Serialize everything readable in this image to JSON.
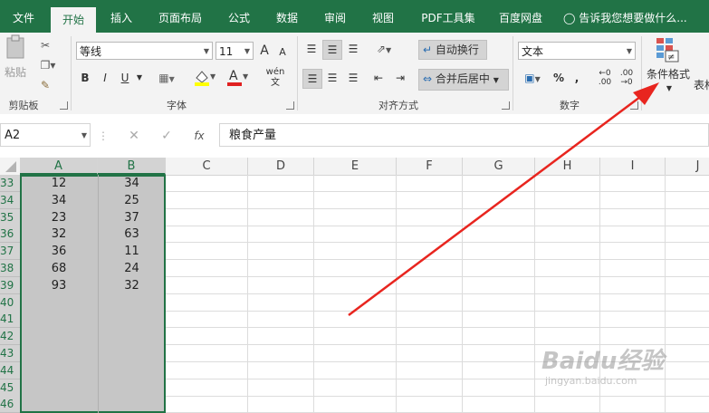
{
  "tabs": [
    "文件",
    "开始",
    "插入",
    "页面布局",
    "公式",
    "数据",
    "审阅",
    "视图",
    "PDF工具集",
    "百度网盘"
  ],
  "active_tab": "开始",
  "tell_me": "告诉我您想要做什么...",
  "ribbon": {
    "clipboard": {
      "paste": "粘贴",
      "label": "剪贴板"
    },
    "font": {
      "name": "等线",
      "size": "11",
      "label": "字体",
      "bold": "B",
      "italic": "I",
      "underline": "U",
      "grow": "A",
      "shrink": "A",
      "wen": "wén"
    },
    "alignment": {
      "wrap": "自动换行",
      "merge": "合并后居中",
      "label": "对齐方式"
    },
    "number": {
      "format": "文本",
      "percent": "%",
      "comma": ",",
      "label": "数字"
    },
    "styles": {
      "conditional": "条件格式",
      "table": "表格"
    }
  },
  "formula_bar": {
    "name_box": "A2",
    "fx": "fx",
    "content": "粮食产量"
  },
  "columns": [
    "A",
    "B",
    "C",
    "D",
    "E",
    "F",
    "G",
    "H",
    "I",
    "J"
  ],
  "rows": [
    {
      "num": "33",
      "a": "12",
      "b": "34"
    },
    {
      "num": "34",
      "a": "34",
      "b": "25"
    },
    {
      "num": "35",
      "a": "23",
      "b": "37"
    },
    {
      "num": "36",
      "a": "32",
      "b": "63"
    },
    {
      "num": "37",
      "a": "36",
      "b": "11"
    },
    {
      "num": "38",
      "a": "68",
      "b": "24"
    },
    {
      "num": "39",
      "a": "93",
      "b": "32"
    },
    {
      "num": "40",
      "a": "",
      "b": ""
    },
    {
      "num": "41",
      "a": "",
      "b": ""
    },
    {
      "num": "42",
      "a": "",
      "b": ""
    },
    {
      "num": "43",
      "a": "",
      "b": ""
    },
    {
      "num": "44",
      "a": "",
      "b": ""
    },
    {
      "num": "45",
      "a": "",
      "b": ""
    },
    {
      "num": "46",
      "a": "",
      "b": ""
    }
  ],
  "watermark": {
    "text": "Baidu经验",
    "url": "jingyan.baidu.com"
  },
  "colors": {
    "excel_green": "#217346",
    "arrow_red": "#e8251f",
    "selection_gray": "#c6c6c6"
  }
}
